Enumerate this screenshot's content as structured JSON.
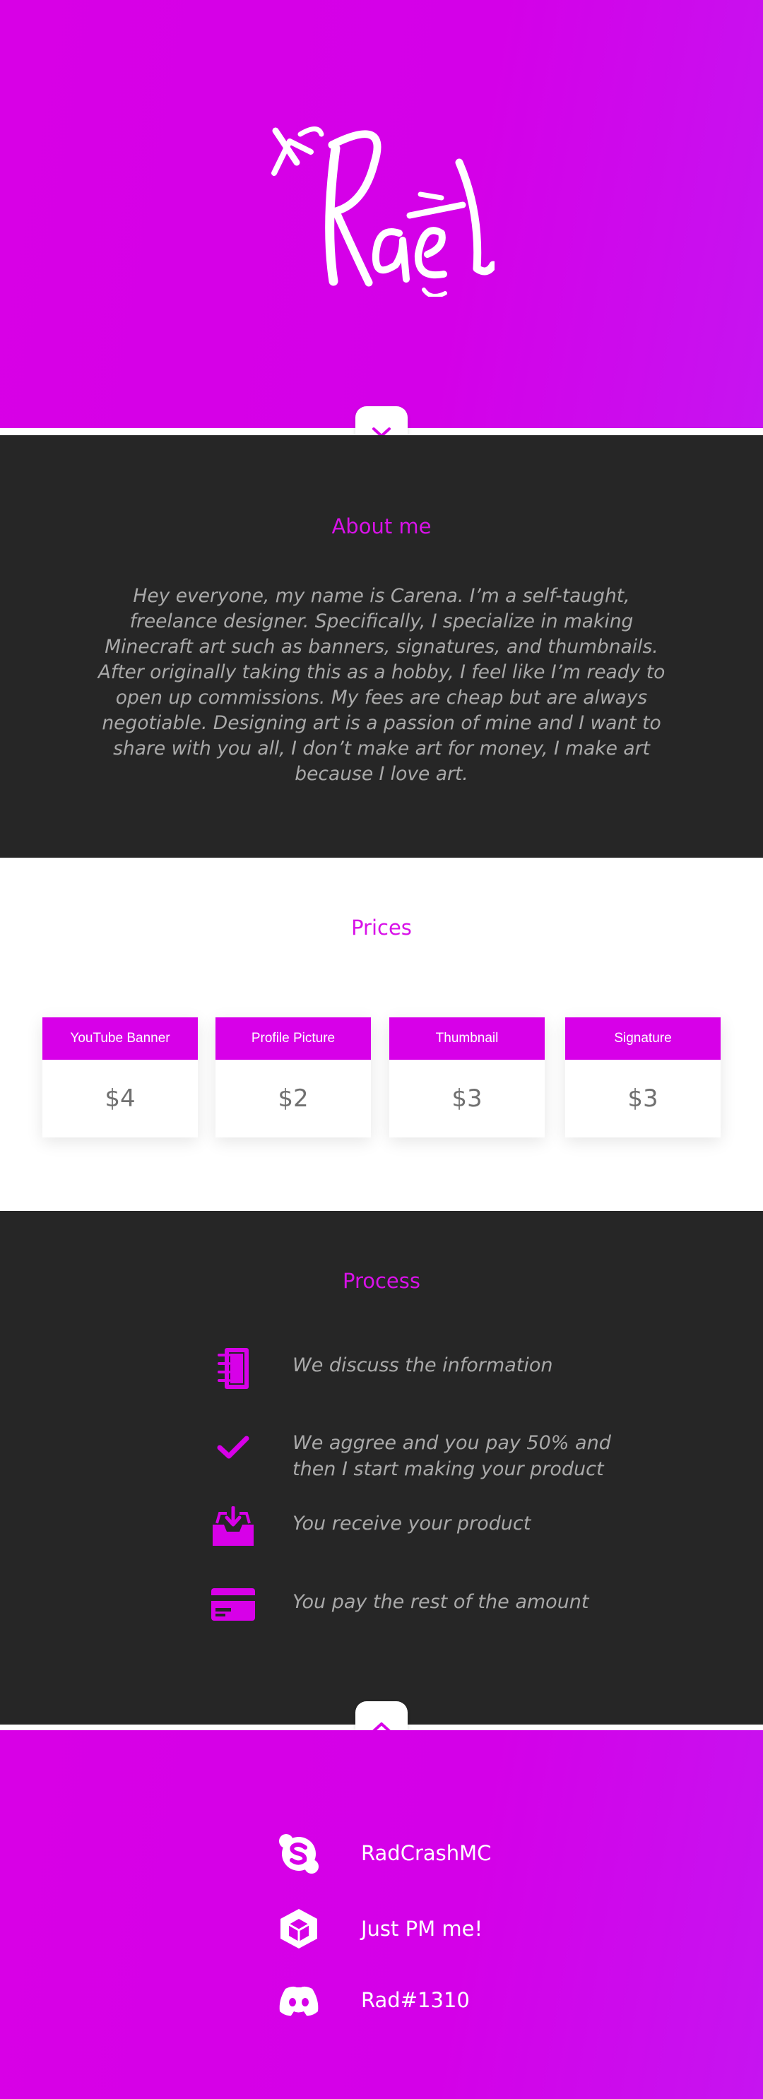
{
  "colors": {
    "accent": "#d700e8",
    "dark_bg": "#262626",
    "muted_text": "#a9a9a9",
    "price_text": "#707070"
  },
  "hero": {
    "logo_alt": "Rad",
    "scroll_down_icon": "chevron-down-icon"
  },
  "about": {
    "title": "About me",
    "body": "Hey everyone, my name is Carena. I’m a self-taught, freelance designer. Specifically, I specialize in making Minecraft art such as banners, signatures, and thumbnails. After originally taking this as a hobby, I feel like I’m ready to open up commissions. My fees are cheap but are always negotiable. Designing art is a passion of mine and I want to share with you all, I don’t make art for money, I make art because I love art."
  },
  "prices": {
    "title": "Prices",
    "items": [
      {
        "label": "YouTube Banner",
        "price": "$4"
      },
      {
        "label": "Profile Picture",
        "price": "$2"
      },
      {
        "label": "Thumbnail",
        "price": "$3"
      },
      {
        "label": "Signature",
        "price": "$3"
      }
    ]
  },
  "process": {
    "title": "Process",
    "steps": [
      {
        "icon": "notebook-icon",
        "text": "We discuss the information"
      },
      {
        "icon": "checkmark-icon",
        "text": "We aggree and you pay 50% and then I start making your product"
      },
      {
        "icon": "inbox-download-icon",
        "text": "You receive your product"
      },
      {
        "icon": "credit-card-icon",
        "text": "You pay the rest of the amount"
      }
    ]
  },
  "contact": {
    "scroll_up_icon": "chevron-up-icon",
    "items": [
      {
        "icon": "skype-icon",
        "text": "RadCrashMC"
      },
      {
        "icon": "cube-icon",
        "text": "Just PM me!"
      },
      {
        "icon": "discord-icon",
        "text": "Rad#1310"
      }
    ]
  }
}
